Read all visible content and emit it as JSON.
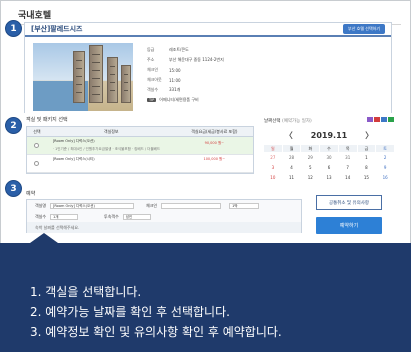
{
  "page": {
    "title": "국내호텔"
  },
  "steps": [
    "1",
    "2",
    "3"
  ],
  "hotel": {
    "name": "[부산]팔레드시즈",
    "select_button": "부산 호텔 선택하기",
    "info": [
      {
        "label": "등급",
        "value": "레조트/콘도"
      },
      {
        "label": "주소",
        "value": "부산 해운대구 중동 1124-2번지"
      },
      {
        "label": "체크인",
        "value": "15:00"
      },
      {
        "label": "체크아웃",
        "value": "11:00"
      },
      {
        "label": "객실수",
        "value": "331개"
      },
      {
        "label": "",
        "value": "어메니티/세면용품 구비",
        "badge": "TIP"
      }
    ]
  },
  "rooms": {
    "section_label": "객실 및 패키지 선택",
    "headers": [
      "선택",
      "객실정보",
      "객실요금(세금/봉사료 포함)"
    ],
    "rows": [
      {
        "name": "[Room Only] 디럭스(오션)",
        "detail": "· 1인기준 / 최대4인 / 인원추가요금발생 · 조식불포함 · 킹베드 / 더블베드",
        "price": "90,000 원~",
        "selected": true
      },
      {
        "name": "[Room Only] 디럭스(시티)",
        "detail": "",
        "price": "100,000 원~",
        "selected": false
      }
    ]
  },
  "calendar": {
    "label": "날짜선택",
    "note": "(예약가능 일자)",
    "month": "2019.11",
    "prev": "〈",
    "next": "〉",
    "dow": [
      "일",
      "월",
      "화",
      "수",
      "목",
      "금",
      "토"
    ],
    "days": [
      "27",
      "28",
      "29",
      "30",
      "31",
      "1",
      "2",
      "3",
      "4",
      "5",
      "6",
      "7",
      "8",
      "9",
      "10",
      "11",
      "12",
      "13",
      "14",
      "15",
      "16"
    ],
    "colors": {
      "sunday": "#d23c3c",
      "saturday": "#3d6fc2"
    }
  },
  "booking": {
    "section_label": "예약",
    "room_label": "객실명",
    "room_value": "[Room Only] 디럭스(오션)",
    "checkin_label": "체크인",
    "nights_value": "1박",
    "rooms_label": "객실수",
    "rooms_value": "1개",
    "guests_label": "투숙객수",
    "guests_value": "성인",
    "date_hint": "숙박 날짜를 선택해주세요.",
    "note_button": "공통취소 및 유의사항",
    "book_button": "예약하기"
  },
  "instructions": [
    "1. 객실을 선택합니다.",
    "2. 예약가능 날짜를 확인 후 선택합니다.",
    "3. 예약정보 확인 및 유의사항 확인 후 예약합니다."
  ],
  "colors": {
    "accent": "#2d80d6",
    "panel": "#1f3a6b",
    "step": "#2a5fa8"
  }
}
